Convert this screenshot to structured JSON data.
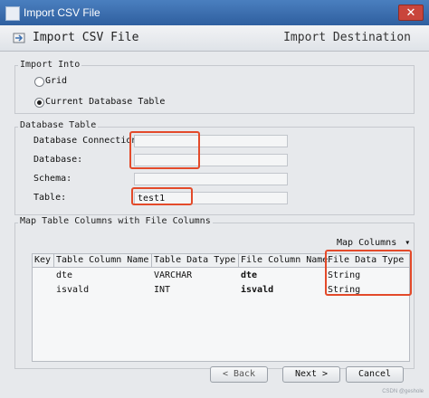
{
  "window": {
    "title": "Import CSV File",
    "close_symbol": "✕"
  },
  "header": {
    "left_title": "Import CSV File",
    "right_title": "Import Destination"
  },
  "import_into": {
    "label": "Import Into",
    "options": [
      "Grid",
      "Current Database Table"
    ],
    "selected": "Current Database Table"
  },
  "database_table": {
    "label": "Database Table",
    "connection_label": "Database Connection",
    "connection_value": "",
    "database_label": "Database:",
    "database_value": "",
    "schema_label": "Schema:",
    "schema_value": "",
    "table_label": "Table:",
    "table_value": "test1"
  },
  "mapping": {
    "label": "Map Table Columns with File Columns",
    "map_columns_button": "Map Columns",
    "map_columns_icon": "dropdown-arrow-icon",
    "columns": [
      "Key",
      "Table Column Name",
      "Table Data Type",
      "File Column Name",
      "File Data Type"
    ],
    "rows": [
      {
        "key": "",
        "table_column_name": "dte",
        "table_data_type": "VARCHAR",
        "file_column_name": "dte",
        "file_data_type": "String"
      },
      {
        "key": "",
        "table_column_name": "isvald",
        "table_data_type": "INT",
        "file_column_name": "isvald",
        "file_data_type": "String"
      }
    ]
  },
  "buttons": {
    "back": "< Back",
    "next": "Next >",
    "cancel": "Cancel"
  },
  "watermark": "CSDN @geshole",
  "colors": {
    "accent": "#3b6fb1",
    "highlight": "#e34a2a"
  }
}
